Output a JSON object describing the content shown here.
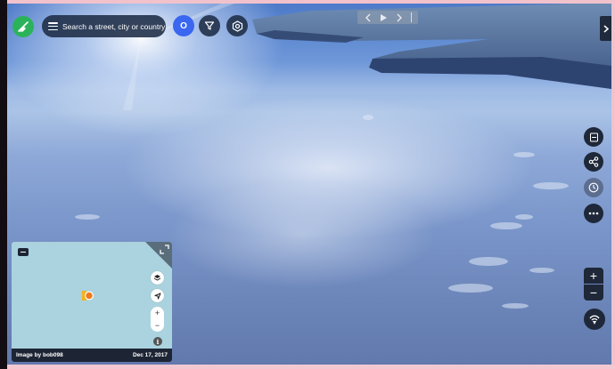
{
  "search": {
    "label": "Search a street, city or country"
  },
  "user": {
    "initial": "O"
  },
  "minimap": {
    "credit": "Image by bob098",
    "date": "Dec 17, 2017",
    "zoom_in": "+",
    "zoom_out": "−",
    "info": "i"
  },
  "zoom": {
    "in": "+",
    "out": "−"
  },
  "icons": {
    "menu": "mapillary-logo-icon",
    "search_menu": "hamburger-icon",
    "filter": "filter-icon",
    "layers": "layers-settings-icon",
    "prev": "chevron-left-icon",
    "play": "play-icon",
    "next": "chevron-right-icon",
    "collapse": "chevron-right-icon",
    "view360": "panorama-icon",
    "share": "share-icon",
    "history": "clock-icon",
    "more": "more-horizontal-icon",
    "compass": "compass-icon",
    "locate": "locate-icon",
    "map_layers": "map-layers-icon",
    "fullscreen": "expand-icon"
  },
  "colors": {
    "brand_green": "#2bb35b",
    "user_blue": "#3a66f0",
    "panel_dark": "#1f2838",
    "marker_orange": "#f07a1a",
    "marker_yellow": "#f6b21c",
    "water": "#aad3df"
  }
}
